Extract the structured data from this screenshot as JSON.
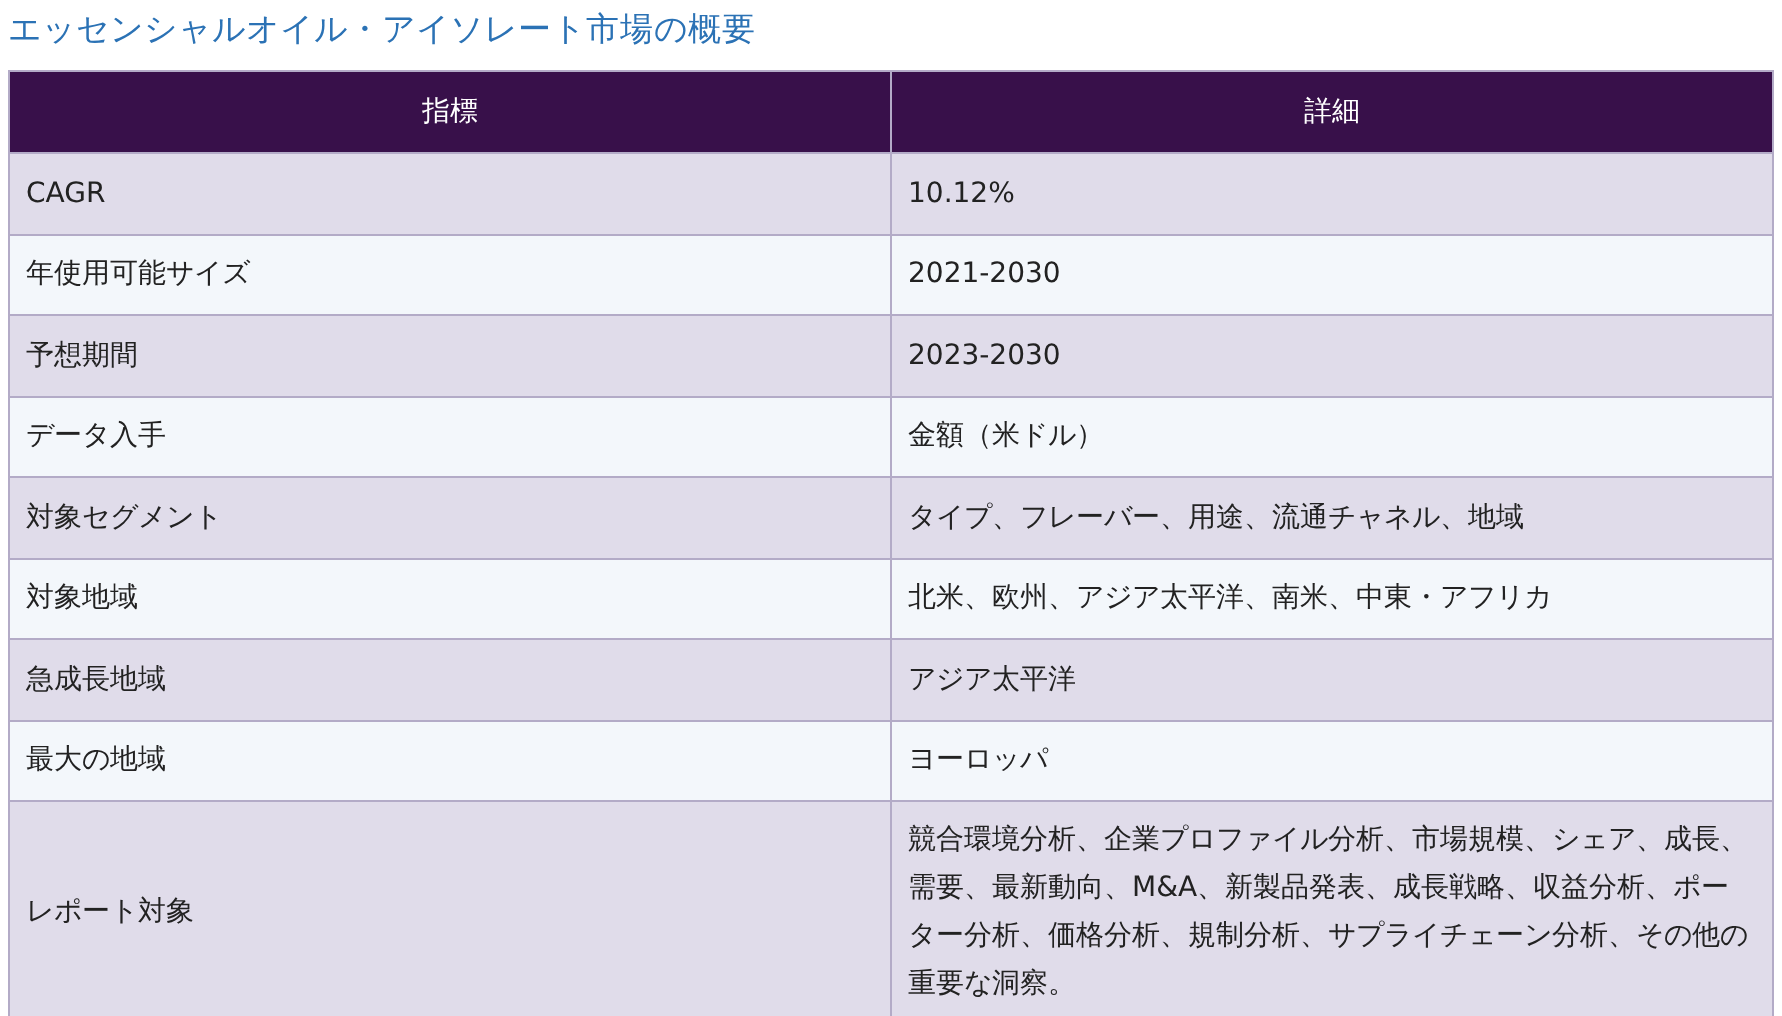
{
  "title": "エッセンシャルオイル・アイソレート市場の概要",
  "table": {
    "columns": [
      "指標",
      "詳細"
    ],
    "rows": [
      [
        "CAGR",
        "10.12%"
      ],
      [
        "年使用可能サイズ",
        "2021-2030"
      ],
      [
        "予想期間",
        "2023-2030"
      ],
      [
        "データ入手",
        "金額（米ドル）"
      ],
      [
        "対象セグメント",
        "タイプ、フレーバー、用途、流通チャネル、地域"
      ],
      [
        "対象地域",
        "北米、欧州、アジア太平洋、南米、中東・アフリカ"
      ],
      [
        "急成長地域",
        "アジア太平洋"
      ],
      [
        "最大の地域",
        "ヨーロッパ"
      ],
      [
        "レポート対象",
        "競合環境分析、企業プロファイル分析、市場規模、シェア、成長、需要、最新動向、M&A、新製品発表、成長戦略、収益分析、ポーター分析、価格分析、規制分析、サプライチェーン分析、その他の重要な洞察。"
      ]
    ]
  }
}
